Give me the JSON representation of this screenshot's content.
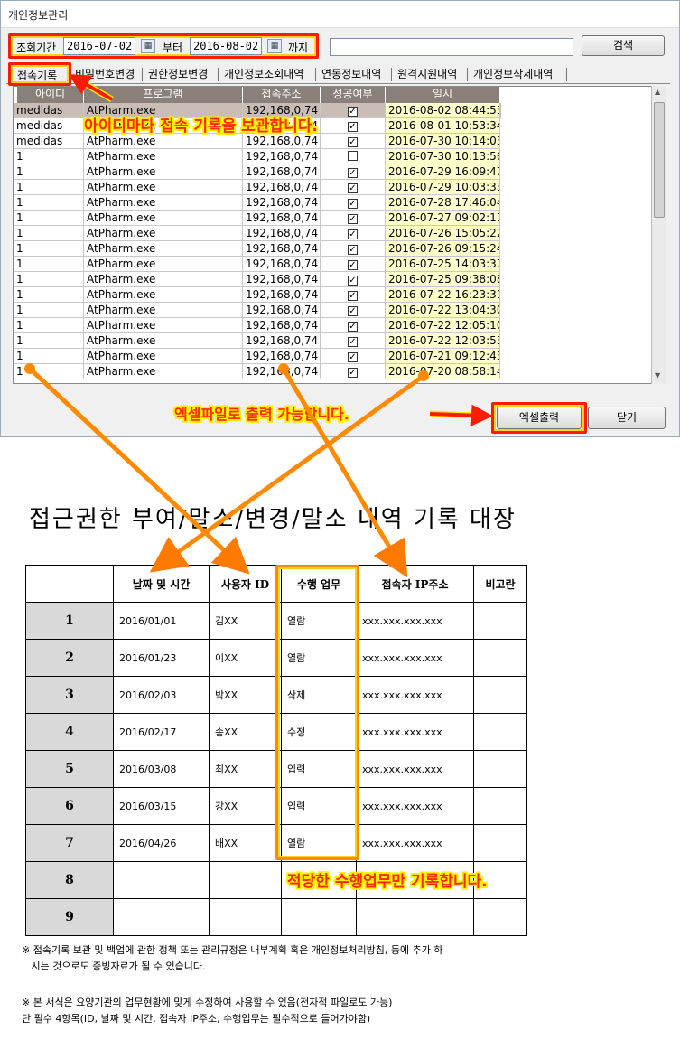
{
  "window": {
    "title": "개인정보관리"
  },
  "search": {
    "period_label": "조회기간",
    "date_from": "2016-07-02",
    "from_label": "부터",
    "date_to": "2016-08-02",
    "to_label": "까지",
    "keyword": "",
    "search_button": "검색"
  },
  "tabs": [
    "접속기록",
    "비밀번호변경",
    "권한정보변경",
    "개인정보조회내역",
    "연동정보내역",
    "원격지원내역",
    "개인정보삭제내역"
  ],
  "grid": {
    "headers": [
      "아이디",
      "프로그램",
      "접속주소",
      "성공여부",
      "일시"
    ],
    "rows": [
      {
        "id": "medidas",
        "program": "AtPharm.exe",
        "ip": "192,168,0,74",
        "success": true,
        "time": "2016-08-02 08:44:53"
      },
      {
        "id": "medidas",
        "program": "AtPharm.exe",
        "ip": "192,168,0,74",
        "success": true,
        "time": "2016-08-01 10:53:34"
      },
      {
        "id": "medidas",
        "program": "AtPharm.exe",
        "ip": "192,168,0,74",
        "success": true,
        "time": "2016-07-30 10:14:03"
      },
      {
        "id": "1",
        "program": "AtPharm.exe",
        "ip": "192,168,0,74",
        "success": false,
        "time": "2016-07-30 10:13:56"
      },
      {
        "id": "1",
        "program": "AtPharm.exe",
        "ip": "192,168,0,74",
        "success": true,
        "time": "2016-07-29 16:09:47"
      },
      {
        "id": "1",
        "program": "AtPharm.exe",
        "ip": "192,168,0,74",
        "success": true,
        "time": "2016-07-29 10:03:33"
      },
      {
        "id": "1",
        "program": "AtPharm.exe",
        "ip": "192,168,0,74",
        "success": true,
        "time": "2016-07-28 17:46:04"
      },
      {
        "id": "1",
        "program": "AtPharm.exe",
        "ip": "192,168,0,74",
        "success": true,
        "time": "2016-07-27 09:02:17"
      },
      {
        "id": "1",
        "program": "AtPharm.exe",
        "ip": "192,168,0,74",
        "success": true,
        "time": "2016-07-26 15:05:22"
      },
      {
        "id": "1",
        "program": "AtPharm.exe",
        "ip": "192,168,0,74",
        "success": true,
        "time": "2016-07-26 09:15:24"
      },
      {
        "id": "1",
        "program": "AtPharm.exe",
        "ip": "192,168,0,74",
        "success": true,
        "time": "2016-07-25 14:03:37"
      },
      {
        "id": "1",
        "program": "AtPharm.exe",
        "ip": "192,168,0,74",
        "success": true,
        "time": "2016-07-25 09:38:08"
      },
      {
        "id": "1",
        "program": "AtPharm.exe",
        "ip": "192,168,0,74",
        "success": true,
        "time": "2016-07-22 16:23:31"
      },
      {
        "id": "1",
        "program": "AtPharm.exe",
        "ip": "192,168,0,74",
        "success": true,
        "time": "2016-07-22 13:04:30"
      },
      {
        "id": "1",
        "program": "AtPharm.exe",
        "ip": "192,168,0,74",
        "success": true,
        "time": "2016-07-22 12:05:10"
      },
      {
        "id": "1",
        "program": "AtPharm.exe",
        "ip": "192,168,0,74",
        "success": true,
        "time": "2016-07-22 12:03:53"
      },
      {
        "id": "1",
        "program": "AtPharm.exe",
        "ip": "192,168,0,74",
        "success": true,
        "time": "2016-07-21 09:12:43"
      },
      {
        "id": "1",
        "program": "AtPharm.exe",
        "ip": "192,168,0,74",
        "success": true,
        "time": "2016-07-20 08:58:14"
      }
    ]
  },
  "buttons": {
    "excel": "엑셀출력",
    "close": "닫기"
  },
  "annotations": {
    "id_note": "아이디마다 접속 기록을 보관합니다.",
    "excel_note": "엑셀파일로 출력 가능합니다.",
    "task_note": "적당한 수행업무만 기록합니다."
  },
  "register": {
    "title": "접근권한 부여/말소/변경/말소 내역 기록 대장",
    "headers": [
      "",
      "날짜 및 시간",
      "사용자 ID",
      "수행 업무",
      "접속자 IP주소",
      "비고란"
    ],
    "rows": [
      {
        "no": "1",
        "date": "2016/01/01",
        "user": "김XX",
        "task": "열람",
        "ip": "xxx.xxx.xxx.xxx",
        "note": ""
      },
      {
        "no": "2",
        "date": "2016/01/23",
        "user": "이XX",
        "task": "열람",
        "ip": "xxx.xxx.xxx.xxx",
        "note": ""
      },
      {
        "no": "3",
        "date": "2016/02/03",
        "user": "박XX",
        "task": "삭제",
        "ip": "xxx.xxx.xxx.xxx",
        "note": ""
      },
      {
        "no": "4",
        "date": "2016/02/17",
        "user": "송XX",
        "task": "수정",
        "ip": "xxx.xxx.xxx.xxx",
        "note": ""
      },
      {
        "no": "5",
        "date": "2016/03/08",
        "user": "최XX",
        "task": "입력",
        "ip": "xxx.xxx.xxx.xxx",
        "note": ""
      },
      {
        "no": "6",
        "date": "2016/03/15",
        "user": "강XX",
        "task": "입력",
        "ip": "xxx.xxx.xxx.xxx",
        "note": ""
      },
      {
        "no": "7",
        "date": "2016/04/26",
        "user": "배XX",
        "task": "열람",
        "ip": "xxx.xxx.xxx.xxx",
        "note": ""
      },
      {
        "no": "8",
        "date": "",
        "user": "",
        "task": "",
        "ip": "",
        "note": ""
      },
      {
        "no": "9",
        "date": "",
        "user": "",
        "task": "",
        "ip": "",
        "note": ""
      }
    ],
    "notes": [
      "※ 접속기록 보관 및 백업에 관한 정책 또는 관리규정은 내부계획 혹은 개인정보처리방침, 등에 추가 하",
      "   시는 것으로도 증빙자료가 될 수 있습니다.",
      "※ 본 서식은 요양기관의 업무현황에 맞게 수정하여 사용할 수 있음(전자적 파일로도 가능)",
      "단 필수 4항목(ID, 날짜 및 시간, 접속자 IP주소, 수행업무는 필수적으로 들어가야함)"
    ]
  },
  "colors": {
    "annotation_red": "#ff2a00",
    "annotation_yellow": "#ffee00",
    "grid_header": "#8a807a",
    "time_bg": "#ffffcc"
  }
}
